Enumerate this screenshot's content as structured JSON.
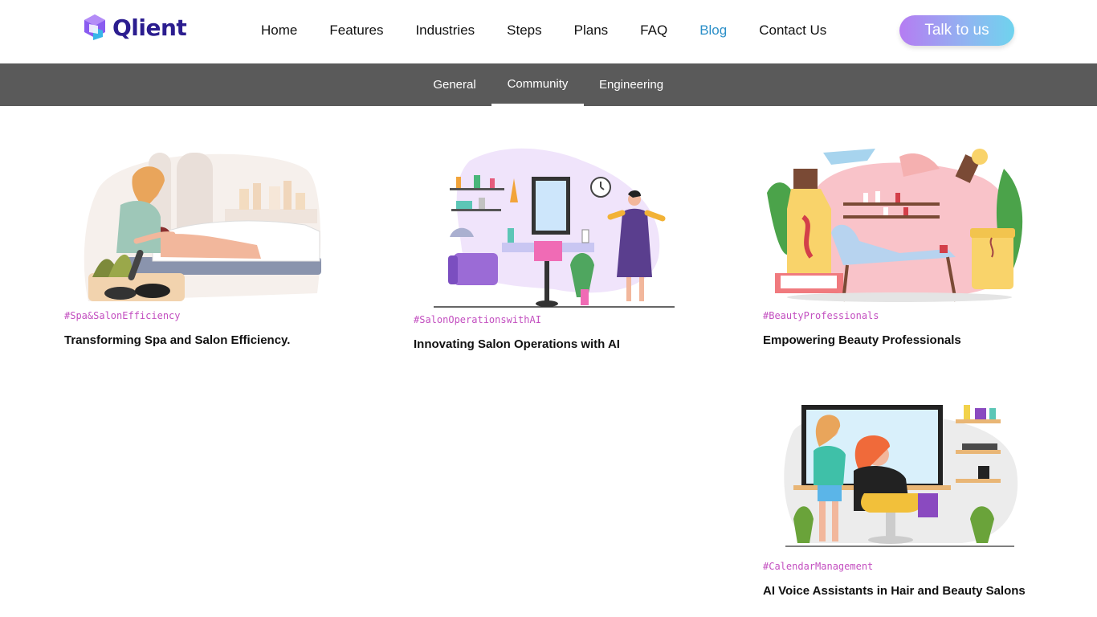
{
  "brand": {
    "name": "Qlient"
  },
  "nav": {
    "items": [
      {
        "label": "Home",
        "active": false
      },
      {
        "label": "Features",
        "active": false
      },
      {
        "label": "Industries",
        "active": false
      },
      {
        "label": "Steps",
        "active": false
      },
      {
        "label": "Plans",
        "active": false
      },
      {
        "label": "FAQ",
        "active": false
      },
      {
        "label": "Blog",
        "active": true
      },
      {
        "label": "Contact Us",
        "active": false
      }
    ],
    "cta_label": "Talk to us"
  },
  "tabs": [
    {
      "label": "General",
      "active": false
    },
    {
      "label": "Community",
      "active": true
    },
    {
      "label": "Engineering",
      "active": false
    }
  ],
  "posts": [
    {
      "tag": "#Spa&SalonEfficiency",
      "title": "Transforming Spa and Salon Efficiency.",
      "image": "spa-massage-illustration"
    },
    {
      "tag": "#SalonOperationswithAI",
      "title": "Innovating Salon Operations with AI",
      "image": "salon-interior-illustration"
    },
    {
      "tag": "#BeautyProfessionals",
      "title": "Empowering Beauty Professionals",
      "image": "beauty-products-illustration"
    },
    {
      "tag": "#CalendarManagement",
      "title": "AI Voice Assistants in Hair and Beauty Salons",
      "image": "hair-salon-illustration"
    }
  ],
  "colors": {
    "accent": "#2b8fc8",
    "tag": "#c34fc0",
    "subnav": "#5a5a5a",
    "brand": "#2b1d8f"
  }
}
